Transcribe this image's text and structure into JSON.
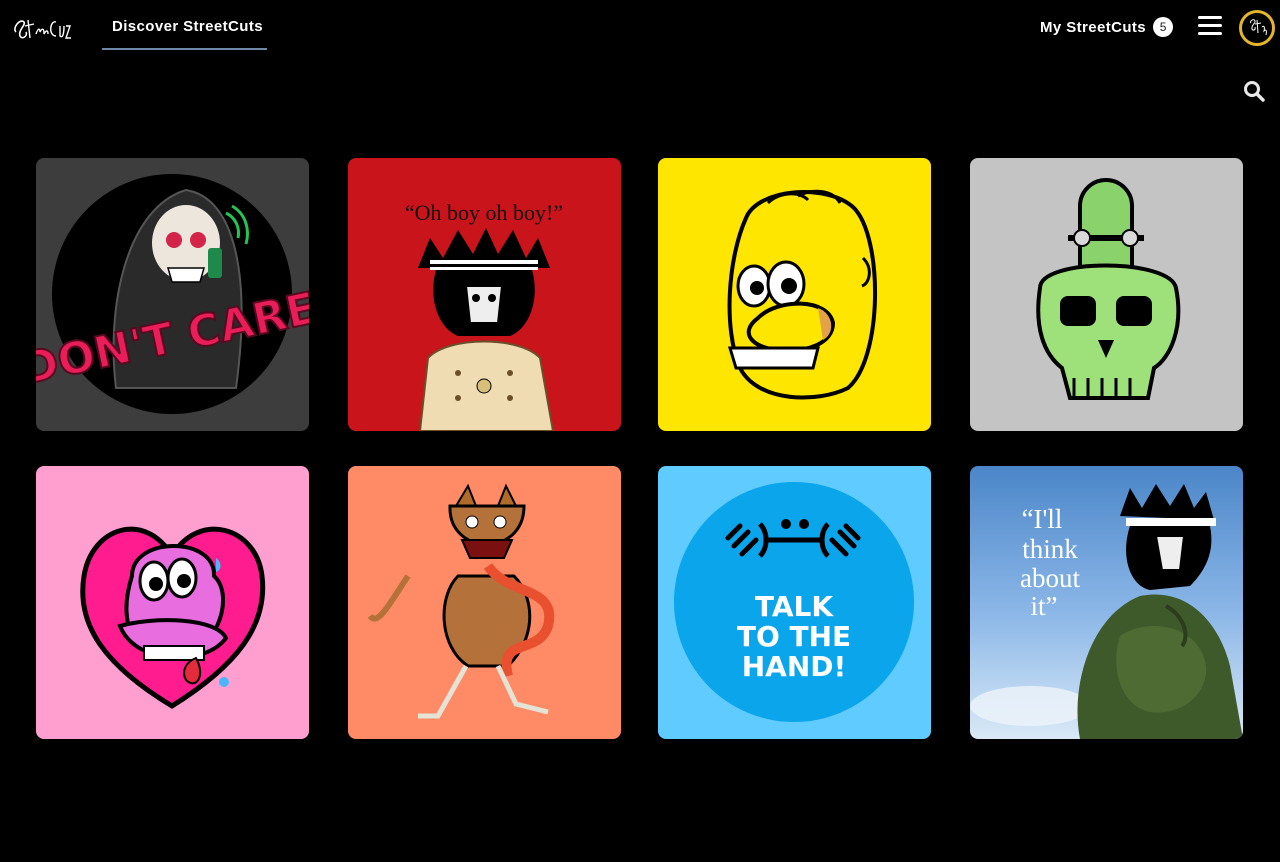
{
  "header": {
    "logo_text": "StreetCutz",
    "nav_discover": "Discover StreetCuts",
    "my_streetcuts_label": "My StreetCuts",
    "my_streetcuts_count": "5",
    "avatar_text": "StreetCutz"
  },
  "colors": {
    "background": "#000000",
    "nav_underline": "#6c8aa8",
    "avatar_ring": "#e6b52c"
  },
  "icons": {
    "menu": "hamburger-menu-icon",
    "search": "search-icon"
  },
  "cards": [
    {
      "name": "reaper",
      "text": "DON'T CARE",
      "bg": "#3d3d3d"
    },
    {
      "name": "oh-boy",
      "text": "“Oh boy oh boy!”",
      "bg": "#c8141a"
    },
    {
      "name": "yellow-face",
      "bg": "#ffe600"
    },
    {
      "name": "skull-skate",
      "bg": "#c4c4c4"
    },
    {
      "name": "pink-heart",
      "bg": "#ff9fd0"
    },
    {
      "name": "zombie-cat",
      "bg": "#ff8a66"
    },
    {
      "name": "talk-hand",
      "line1": "TALK",
      "line2": "TO THE",
      "line3": "HAND!",
      "bg": "#5fcbff"
    },
    {
      "name": "thinker",
      "line1": "“I'll",
      "line2": "think",
      "line3": "about",
      "line4": "it”",
      "bg": "#4b86c9"
    }
  ]
}
